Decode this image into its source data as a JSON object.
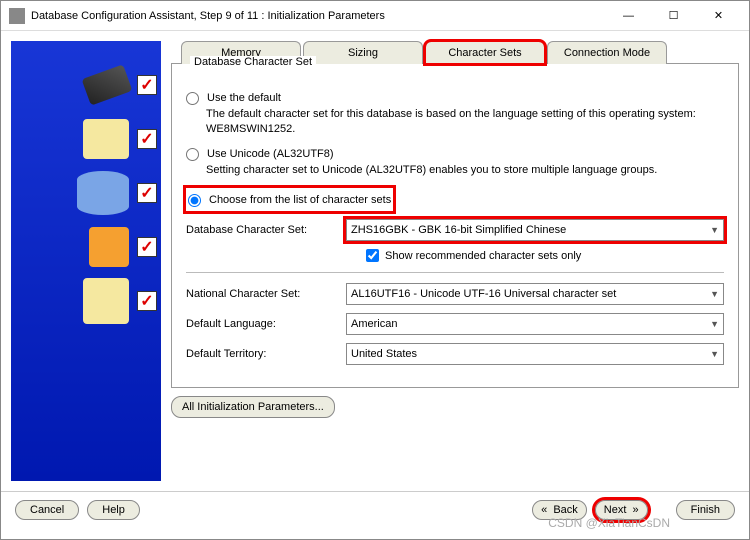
{
  "window": {
    "title": "Database Configuration Assistant, Step 9 of 11 : Initialization Parameters"
  },
  "tabs": {
    "memory": "Memory",
    "sizing": "Sizing",
    "charsets": "Character Sets",
    "connmode": "Connection Mode"
  },
  "group": {
    "title": "Database Character Set",
    "opt1_label": "Use the default",
    "opt1_desc": "The default character set for this database is based on the language setting of this operating system: WE8MSWIN1252.",
    "opt2_label": "Use Unicode (AL32UTF8)",
    "opt2_desc": "Setting character set to Unicode (AL32UTF8) enables you to store multiple language groups.",
    "opt3_label": "Choose from the list of character sets",
    "db_charset_label": "Database Character Set:",
    "db_charset_value": "ZHS16GBK - GBK 16-bit Simplified Chinese",
    "show_rec_label": "Show recommended character sets only",
    "national_label": "National Character Set:",
    "national_value": "AL16UTF16 - Unicode UTF-16 Universal character set",
    "lang_label": "Default Language:",
    "lang_value": "American",
    "terr_label": "Default Territory:",
    "terr_value": "United States"
  },
  "buttons": {
    "all_params": "All Initialization Parameters...",
    "cancel": "Cancel",
    "help": "Help",
    "back": "Back",
    "next": "Next",
    "finish": "Finish"
  },
  "watermark": "CSDN @XiaTianCsDN"
}
